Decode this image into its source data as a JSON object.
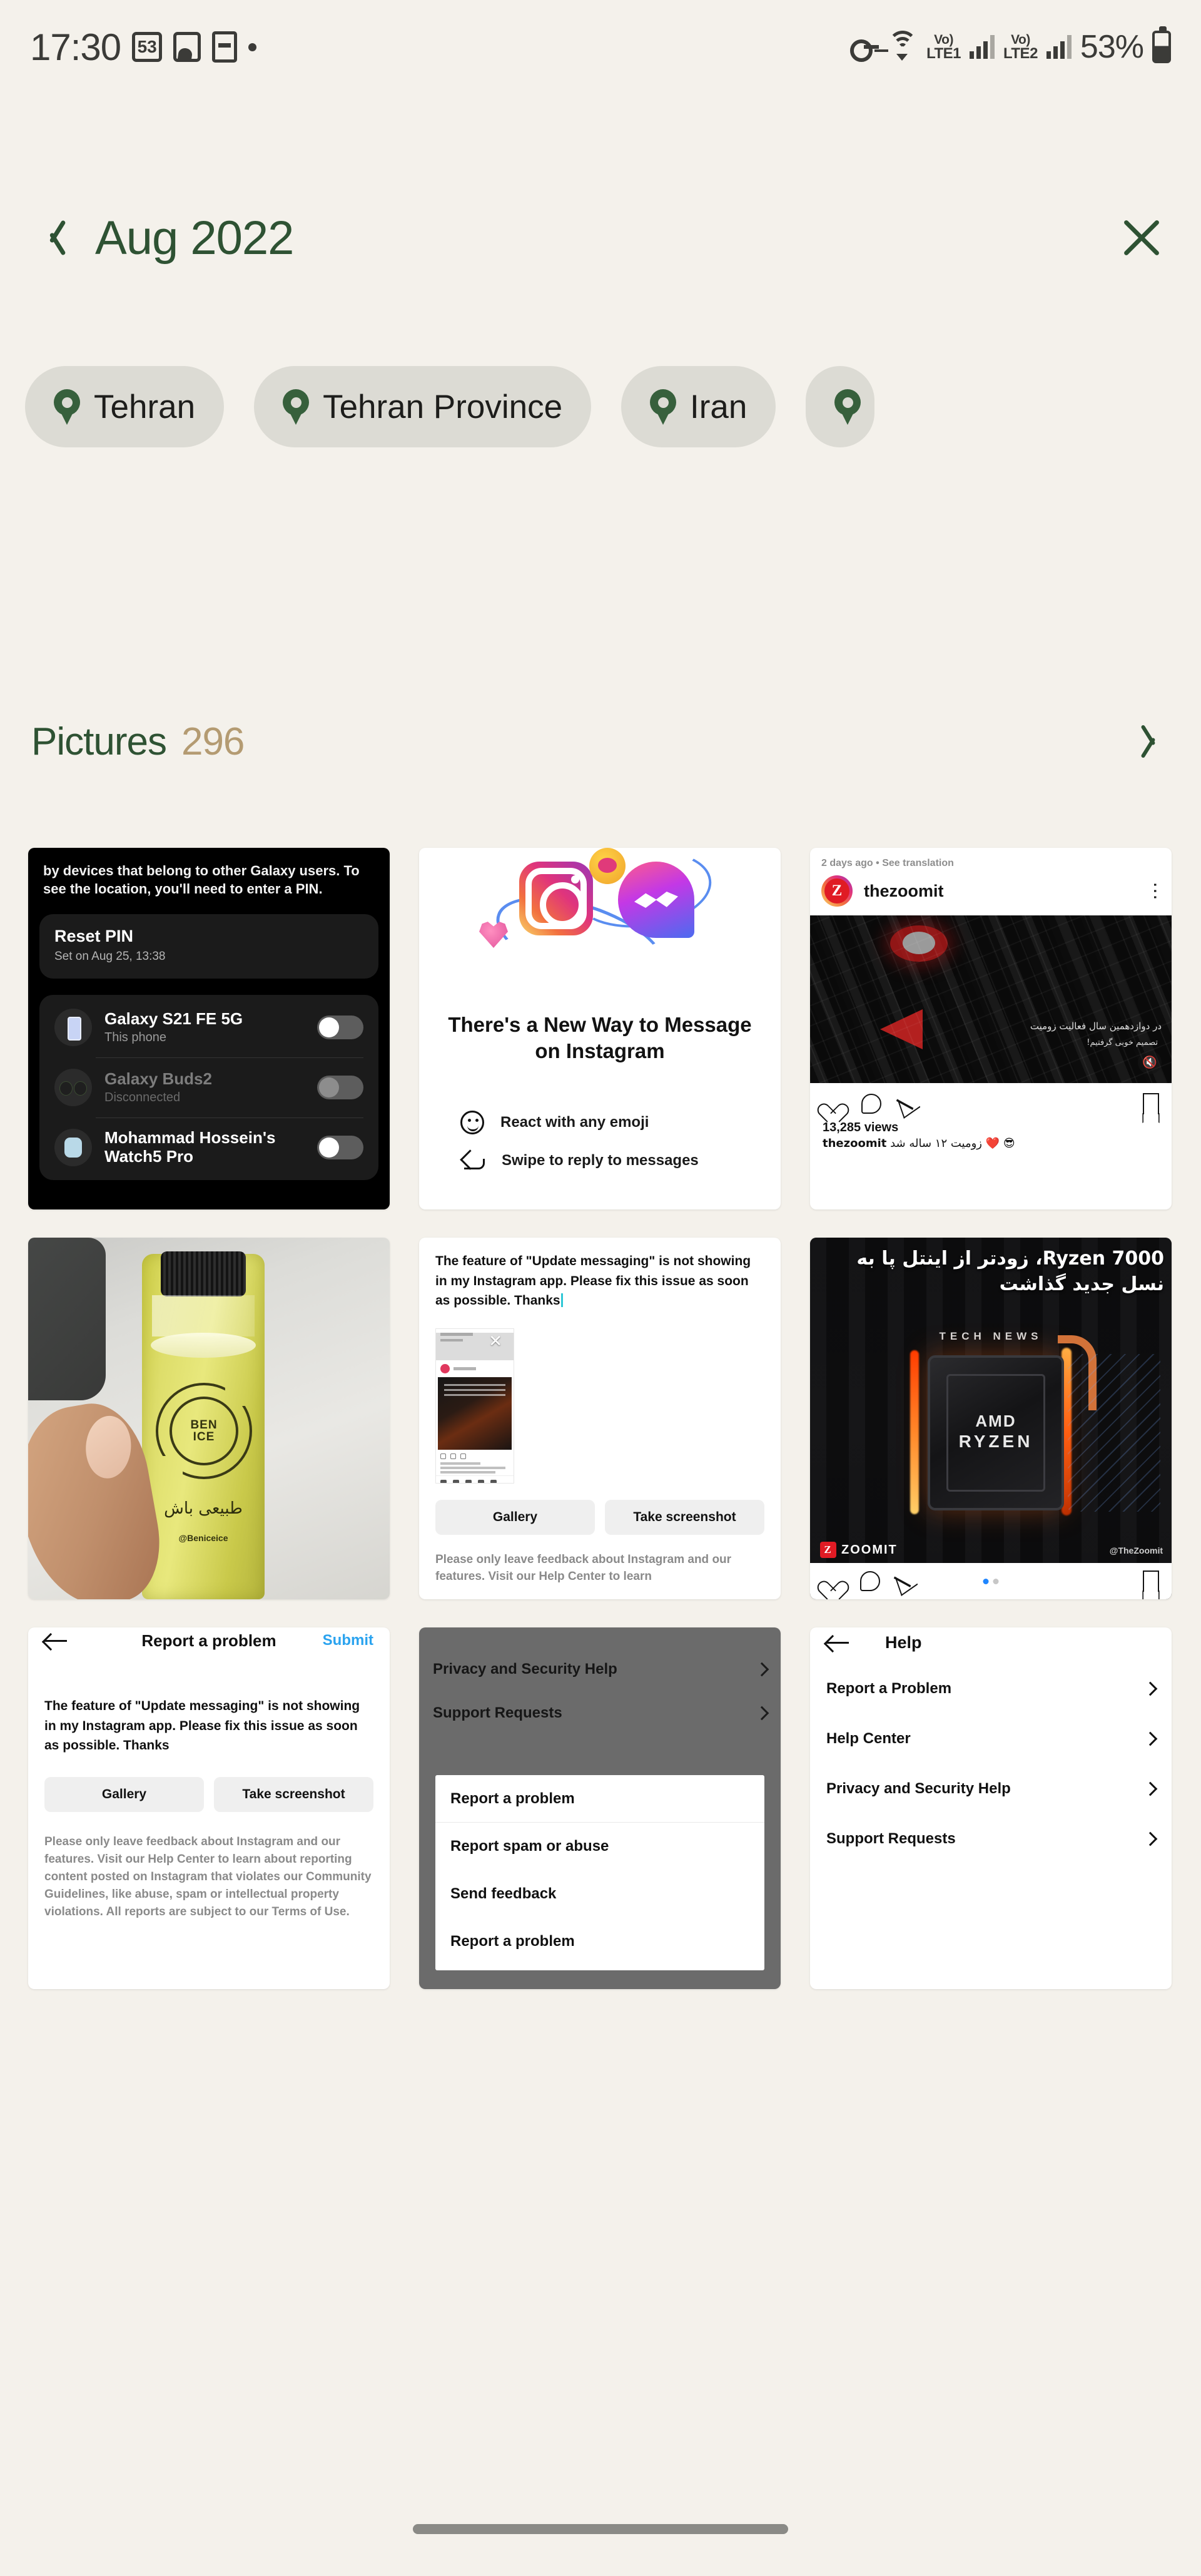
{
  "status_bar": {
    "time": "17:30",
    "notif_badge": "53",
    "battery_percent": "53%",
    "sim1_label": "LTE1",
    "sim2_label": "LTE2",
    "volte_label": "Vo)"
  },
  "header": {
    "title": "Aug 2022",
    "back_icon": "chevron-left-icon",
    "close_icon": "close-icon"
  },
  "location_chips": [
    {
      "label": "Tehran"
    },
    {
      "label": "Tehran Province"
    },
    {
      "label": "Iran"
    },
    {
      "label": ""
    }
  ],
  "section": {
    "title": "Pictures",
    "count": "296",
    "chevron_icon": "chevron-right-icon"
  },
  "colors": {
    "background": "#f4f1eb",
    "accent_green": "#2e5233",
    "count_gold": "#b49b72",
    "chip_bg": "#dcdbd4",
    "pin_green": "#37603c",
    "link_blue": "#2aa3ef"
  },
  "thumbnails": [
    {
      "id": "galaxy-find-my-mobile",
      "lead": "by devices that belong to other Galaxy users. To see the location, you'll need to enter a PIN.",
      "card_title": "Reset PIN",
      "card_subtitle": "Set on Aug 25, 13:38",
      "devices": [
        {
          "name": "Galaxy S21 FE 5G",
          "status": "This phone",
          "toggle": "on"
        },
        {
          "name": "Galaxy Buds2",
          "status": "Disconnected",
          "toggle": "off"
        },
        {
          "name": "Mohammad Hossein's Watch5 Pro",
          "status": "",
          "toggle": "on"
        }
      ]
    },
    {
      "id": "instagram-messaging-promo",
      "heading": "There's a New Way to Message on Instagram",
      "features": [
        {
          "icon": "smiley-icon",
          "label": "React with any emoji"
        },
        {
          "icon": "reply-arrow-icon",
          "label": "Swipe to reply to messages"
        }
      ]
    },
    {
      "id": "thezoomit-post",
      "meta": "2 days ago • See translation",
      "handle": "thezoomit",
      "avatar_letter": "Z",
      "overlay_line1": "در دوازدهمین سال فعالیت زومیت",
      "overlay_line2": "تصمیم خوبی گرفتیم!",
      "views": "13,285 views",
      "caption_user": "thezoomit",
      "caption_text": "زومیت ۱۲ ساله شد ❤️ 😎",
      "actions": [
        "heart-icon",
        "comment-icon",
        "share-icon",
        "save-icon"
      ],
      "mute_icon": "muted-speaker-icon"
    },
    {
      "id": "benice-juice-photo",
      "brand_line1": "BEN",
      "brand_line2": "ICE",
      "slogan_fa": "طبیعی باش",
      "handle": "@Beniceice"
    },
    {
      "id": "instagram-report-with-attachment",
      "body": "The feature of \"Update messaging\" is not showing in my Instagram app. Please fix this issue as soon as possible. Thanks",
      "buttons": [
        "Gallery",
        "Take screenshot"
      ],
      "note": "Please only leave feedback about Instagram and our features. Visit our Help Center to learn"
    },
    {
      "id": "amd-ryzen-7000-post",
      "title_fa": "Ryzen 7000، زودتر از اینتل پا به نسل جدید گذاشت",
      "tech_news": "TECH NEWS",
      "chip_brand": "AMD",
      "chip_line2": "RYZEN",
      "watermark": "ZOOMIT",
      "social_handle": "@TheZoomit",
      "actions": [
        "heart-icon",
        "comment-icon",
        "share-icon",
        "save-icon"
      ]
    },
    {
      "id": "report-a-problem-screen",
      "nav_title": "Report a problem",
      "submit_label": "Submit",
      "body": "The feature of \"Update messaging\" is not showing in my Instagram app. Please fix this issue as soon as possible. Thanks",
      "buttons": [
        "Gallery",
        "Take screenshot"
      ],
      "note": "Please only leave feedback about Instagram and our features. Visit our Help Center to learn about reporting content posted on Instagram that violates our Community Guidelines, like abuse, spam or intellectual property violations. All reports are subject to our Terms of Use."
    },
    {
      "id": "help-sheet-menu",
      "rows": [
        "Privacy and Security Help",
        "Support Requests"
      ],
      "sheet_items": [
        "Report a problem",
        "Report spam or abuse",
        "Send feedback",
        "Report a problem"
      ]
    },
    {
      "id": "help-screen",
      "nav_title": "Help",
      "items": [
        "Report a Problem",
        "Help Center",
        "Privacy and Security Help",
        "Support Requests"
      ]
    }
  ]
}
